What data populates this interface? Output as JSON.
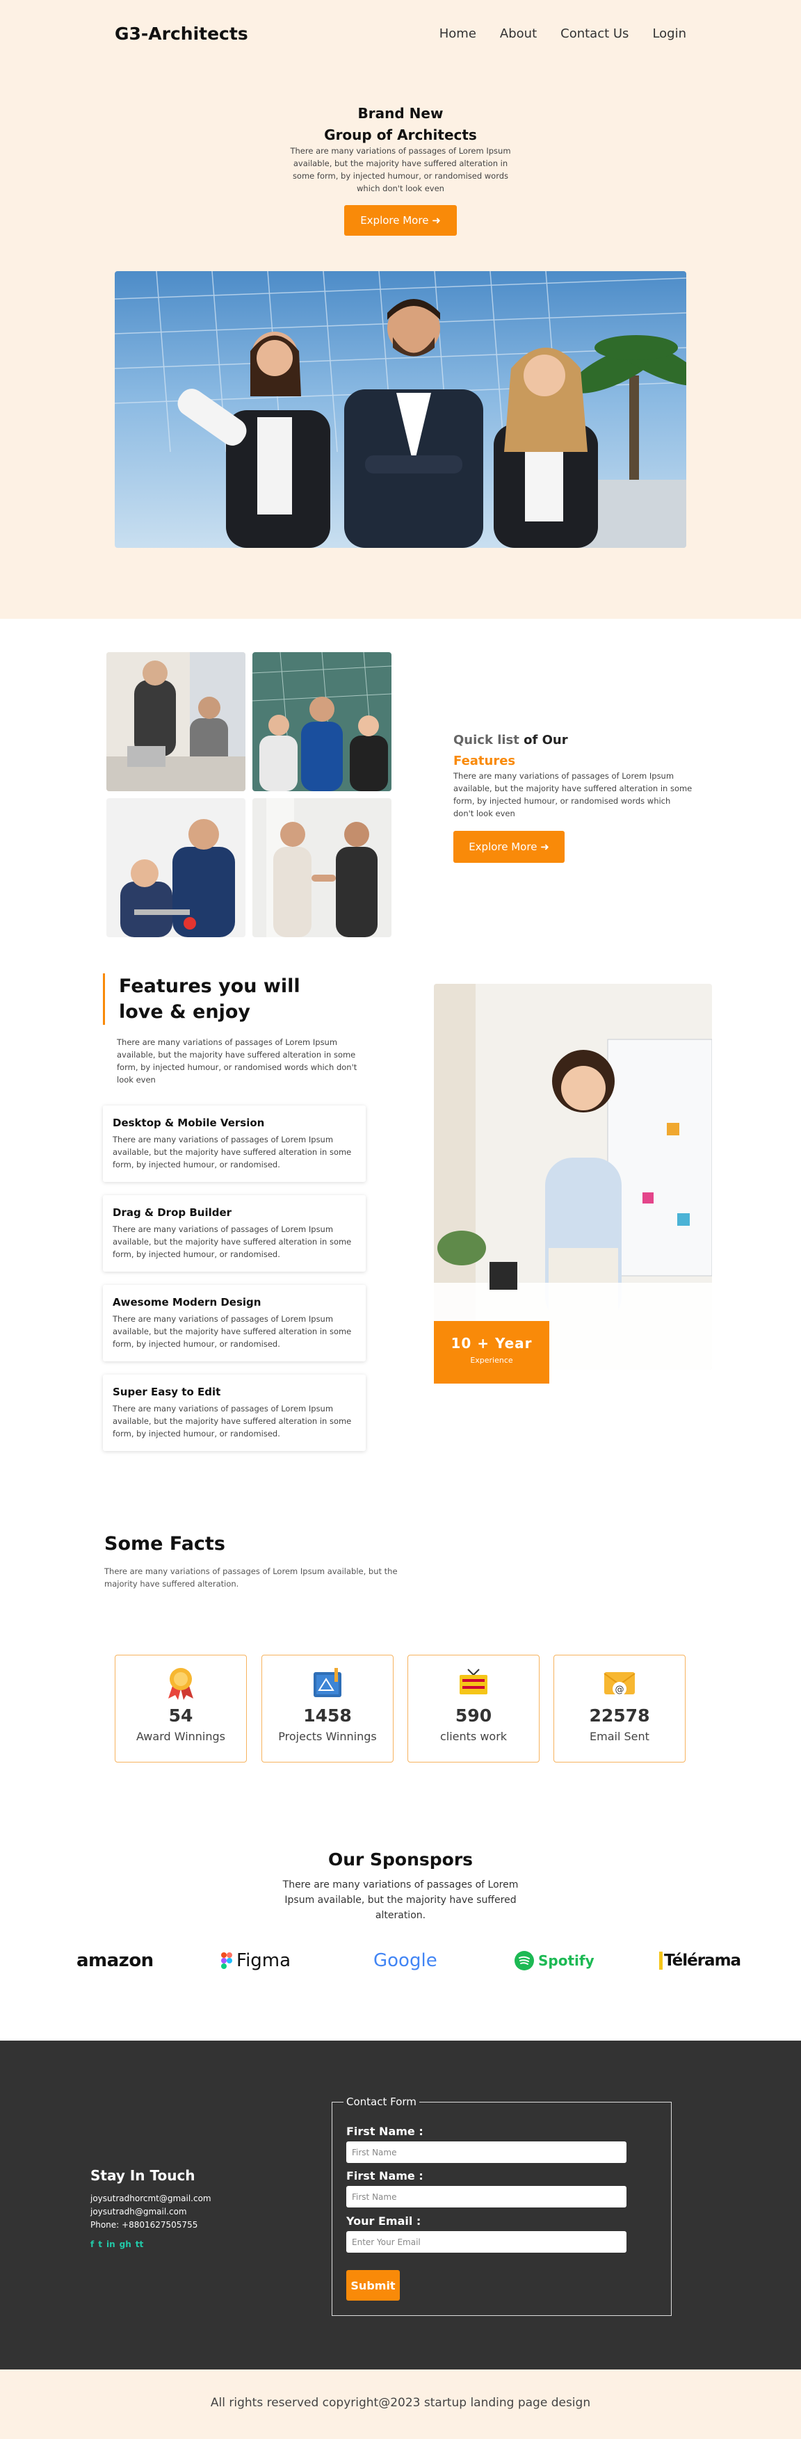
{
  "nav": {
    "brand": "G3-Architects",
    "links": [
      "Home",
      "About",
      "Contact Us",
      "Login"
    ]
  },
  "hero": {
    "title_line1": "Brand New",
    "title_line2": "Group of Architects",
    "text": "There are many variations of passages of Lorem Ipsum available, but the majority have suffered alteration in some form, by injected humour, or randomised words which don't look even",
    "button": "Explore More"
  },
  "quick_list": {
    "title_part1": "Quick list",
    "title_part2": "of Our",
    "title_part3": "Features",
    "text": "There are many variations of passages of Lorem Ipsum available, but the majority have suffered alteration in some form, by injected humour, or randomised words which don't look even",
    "button": "Explore More"
  },
  "features": {
    "heading_line1": "Features you will",
    "heading_line2": "love & enjoy",
    "intro": "There are many variations of passages of Lorem Ipsum available, but the majority have suffered alteration in some form, by injected humour, or randomised words which don't look even",
    "cards": [
      {
        "title": "Desktop & Mobile Version",
        "text": "There are many variations of passages of Lorem Ipsum available, but the majority have suffered alteration in some form, by injected humour, or randomised."
      },
      {
        "title": "Drag & Drop Builder",
        "text": "There are many variations of passages of Lorem Ipsum available, but the majority have suffered alteration in some form, by injected humour, or randomised."
      },
      {
        "title": "Awesome Modern Design",
        "text": "There are many variations of passages of Lorem Ipsum available, but the majority have suffered alteration in some form, by injected humour, or randomised."
      },
      {
        "title": "Super Easy to Edit",
        "text": "There are many variations of passages of Lorem Ipsum available, but the majority have suffered alteration in some form, by injected humour, or randomised."
      }
    ],
    "badge_big": "10 + Year",
    "badge_small": "Experience"
  },
  "facts": {
    "title": "Some Facts",
    "text": "There are many variations of passages of Lorem Ipsum available, but the majority have suffered alteration.",
    "stats": [
      {
        "value": "54",
        "label": "Award Winnings",
        "icon": "award-medal-icon"
      },
      {
        "value": "1458",
        "label": "Projects Winnings",
        "icon": "blueprint-icon"
      },
      {
        "value": "590",
        "label": "clients work",
        "icon": "work-sign-icon"
      },
      {
        "value": "22578",
        "label": "Email Sent",
        "icon": "email-icon"
      }
    ]
  },
  "sponsors": {
    "title": "Our Sponspors",
    "text": "There are many variations of passages of Lorem Ipsum available, but the majority have suffered alteration.",
    "logos": [
      "amazon",
      "Figma",
      "Google",
      "Spotify",
      "Télérama"
    ]
  },
  "footer": {
    "stay_title": "Stay In Touch",
    "email1": "joysutradhorcmt@gmail.com",
    "email2": "joysutradh@gmail.com",
    "phone": "Phone: +8801627505755",
    "socials": [
      "f",
      "t",
      "in",
      "gh",
      "tt"
    ],
    "form": {
      "legend": "Contact Form",
      "label1": "First Name :",
      "placeholder1": "First Name",
      "label2": "First Name :",
      "placeholder2": "First Name",
      "label3": "Your Email :",
      "placeholder3": "Enter Your Email",
      "submit": "Submit"
    }
  },
  "copyright": "All rights reserved copyright@2023 startup landing page design",
  "colors": {
    "accent": "#f98a09",
    "hero_bg": "#fdf1e4",
    "footer_bg": "#333333"
  }
}
